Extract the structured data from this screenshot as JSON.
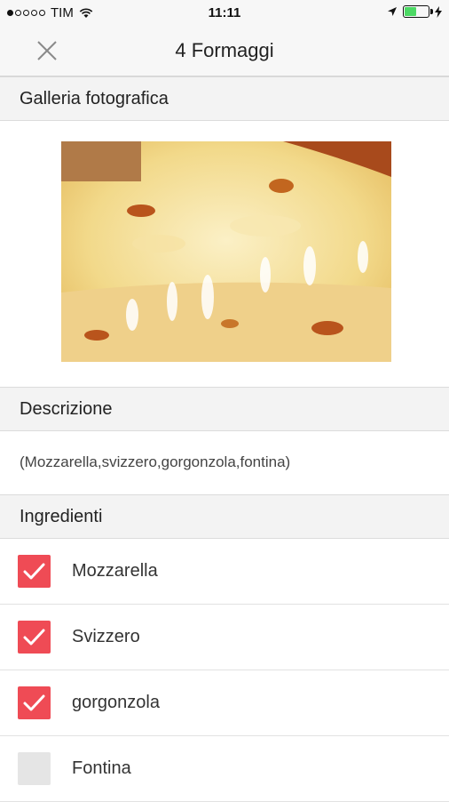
{
  "status_bar": {
    "carrier": "TIM",
    "time": "11:11",
    "signal_bars_filled": 1,
    "signal_bars_total": 5,
    "battery_level": 0.5
  },
  "nav": {
    "title": "4 Formaggi",
    "close_icon": "close-icon"
  },
  "gallery": {
    "header": "Galleria fotografica",
    "photo_alt": "pizza-photo"
  },
  "description": {
    "header": "Descrizione",
    "text": "(Mozzarella,svizzero,gorgonzola,fontina)"
  },
  "ingredients": {
    "header": "Ingredienti",
    "items": [
      {
        "label": "Mozzarella",
        "checked": true
      },
      {
        "label": "Svizzero",
        "checked": true
      },
      {
        "label": "gorgonzola",
        "checked": true
      },
      {
        "label": "Fontina",
        "checked": false
      }
    ]
  },
  "colors": {
    "accent": "#ef4b55",
    "unchecked": "#e5e5e5",
    "battery": "#4cd964"
  }
}
